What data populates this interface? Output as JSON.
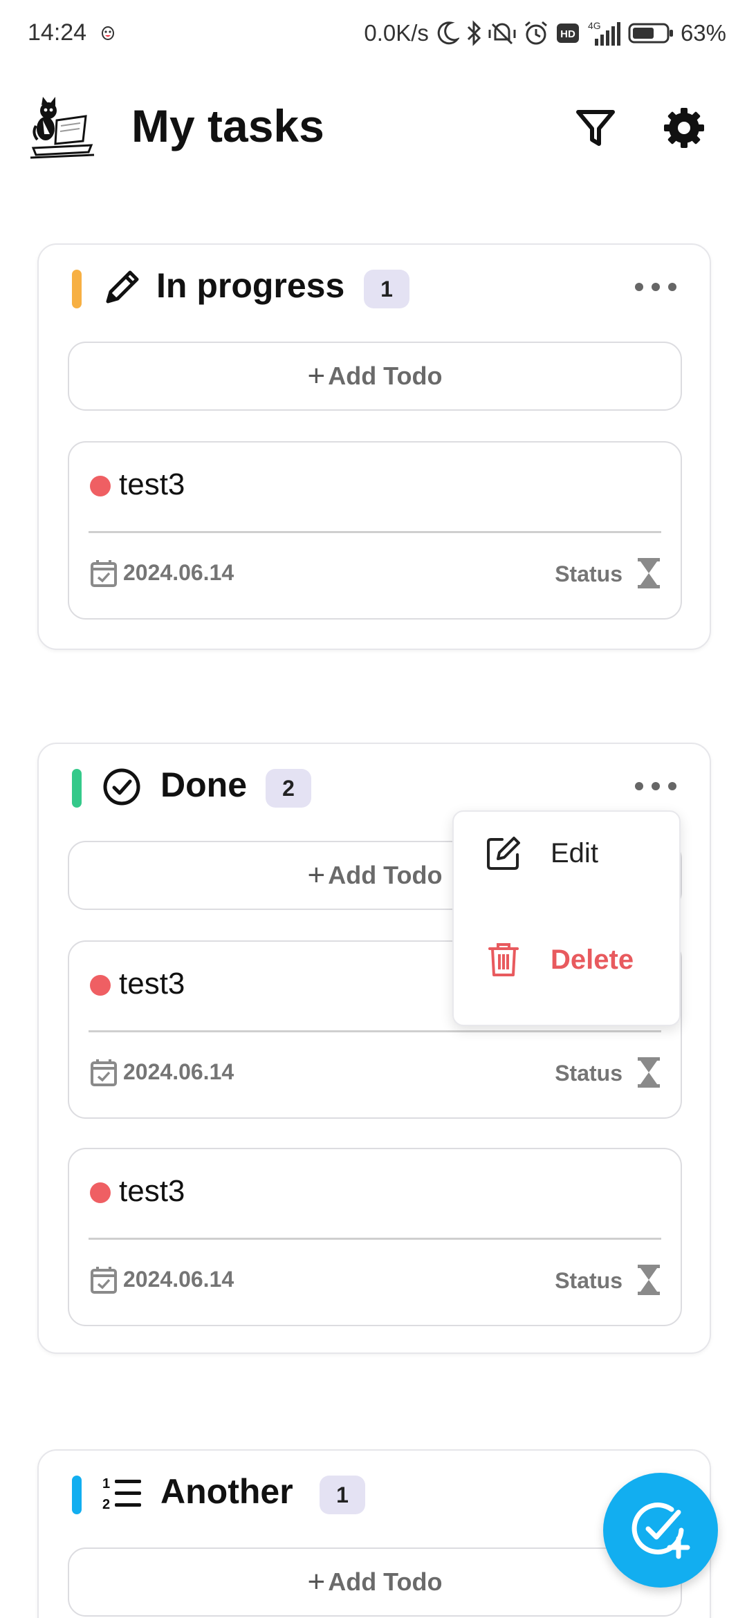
{
  "status_bar": {
    "time": "14:24",
    "network_speed": "0.0K/s",
    "network_type": "4G",
    "battery_percent": "63%",
    "icons": [
      "moon-icon",
      "bluetooth-icon",
      "vibrate-off-icon",
      "alarm-icon",
      "hd-icon",
      "signal-icon",
      "battery-icon"
    ]
  },
  "header": {
    "title": "My tasks",
    "icons": [
      "cat-logo-icon",
      "filter-icon",
      "gear-icon"
    ]
  },
  "groups": [
    {
      "title": "In progress",
      "count": "1",
      "accent_color": "#f7b043",
      "icon": "pencil-icon",
      "add_label": "Add Todo",
      "todos": [
        {
          "name": "test3",
          "date": "2024.06.14",
          "status_label": "Status"
        }
      ]
    },
    {
      "title": "Done",
      "count": "2",
      "accent_color": "#34c98a",
      "icon": "check-circle-icon",
      "add_label": "Add Todo",
      "todos": [
        {
          "name": "test3",
          "date": "2024.06.14",
          "status_label": "Status"
        },
        {
          "name": "test3",
          "date": "2024.06.14",
          "status_label": "Status"
        }
      ]
    },
    {
      "title": "Another",
      "count": "1",
      "accent_color": "#12aef0",
      "icon": "numbered-list-icon",
      "add_label": "Add Todo",
      "todos": []
    }
  ],
  "context_menu": {
    "edit_label": "Edit",
    "delete_label": "Delete",
    "delete_color": "#e85a5e"
  },
  "fab": {
    "icon": "add-task-icon",
    "color": "#12aef0"
  },
  "todo_dot_color": "#ef5f63"
}
